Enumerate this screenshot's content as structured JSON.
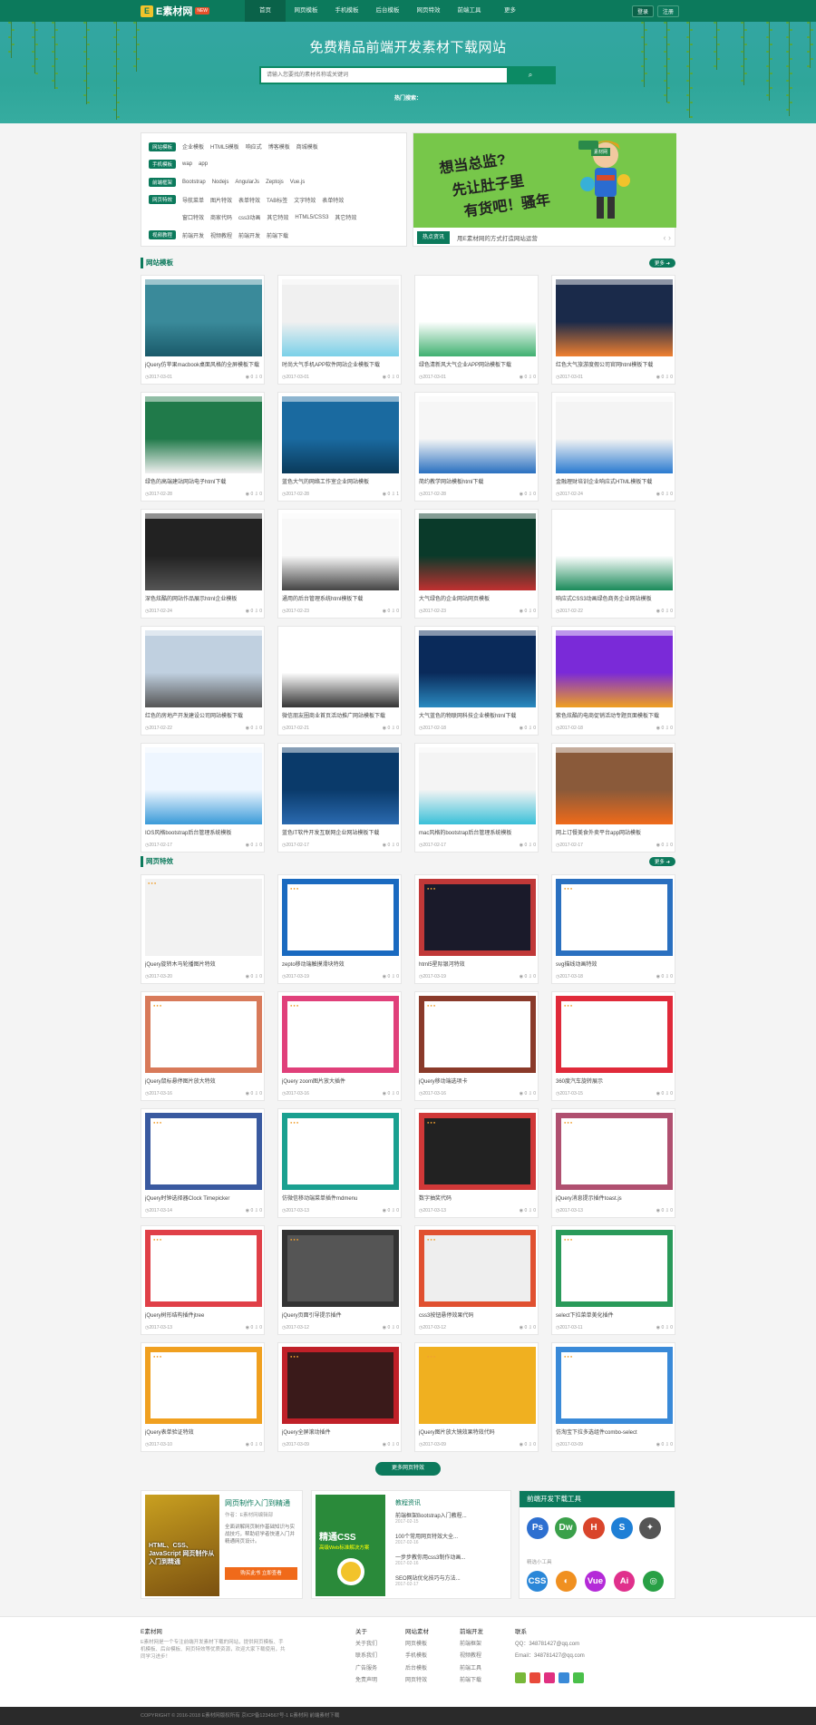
{
  "header": {
    "logo_mark": "E",
    "logo_name": "E素材网",
    "logo_tag": "NEW",
    "nav": [
      "首页",
      "网页模板",
      "手机模板",
      "后台模板",
      "网页特效",
      "前端工具",
      "更多"
    ],
    "login": "登录",
    "register": "注册"
  },
  "hero": {
    "title": "免费精品前端开发素材下载网站",
    "search_placeholder": "请输入您要找的素材名称或关键词",
    "search_button": "搜索",
    "hot_label": "热门搜索："
  },
  "categories": [
    {
      "label": "网站模板",
      "items": [
        "企业模板",
        "HTML5模板",
        "响应式",
        "博客模板",
        "商城模板"
      ]
    },
    {
      "label": "手机模板",
      "items": [
        "wap",
        "app"
      ]
    },
    {
      "label": "前端框架",
      "items": [
        "Bootstrap",
        "Nodejs",
        "AngularJs",
        "Zeptojs",
        "Vue.js"
      ]
    },
    {
      "label": "网页特效",
      "items": [
        "导航菜单",
        "图片特效",
        "表单特效",
        "TAB标签",
        "文字特效",
        "表单特效"
      ]
    },
    {
      "label": "",
      "items": [
        "窗口特效",
        "商家代码",
        "css3动画",
        "其它特效",
        "HTML5/CSS3",
        "其它特效"
      ]
    },
    {
      "label": "视频教程",
      "items": [
        "前端开发",
        "视频教程",
        "前端开发",
        "前端下载"
      ]
    }
  ],
  "banner": {
    "line1": "想当总监?",
    "line2": "先让肚子里",
    "line3": "有货吧！骚年",
    "badge": "素材网",
    "news_label": "热点资讯",
    "news_text": "用E素材网的方式打造网站运营"
  },
  "templates": {
    "title": "网站模板",
    "more": "更多",
    "items": [
      {
        "title": "jQuery仿苹果macbook桌面风格的全屏模板下载",
        "date": "2017-03-01",
        "views": "0",
        "downs": "0"
      },
      {
        "title": "时尚大气手机APP软件网站企业模板下载",
        "date": "2017-03-01",
        "views": "0",
        "downs": "0"
      },
      {
        "title": "绿色清新风大气企业APP网站模板下载",
        "date": "2017-03-01",
        "views": "0",
        "downs": "0"
      },
      {
        "title": "红色大气旅游度假公司官网html模板下载",
        "date": "2017-03-01",
        "views": "0",
        "downs": "0"
      },
      {
        "title": "绿色的高端建站网站电子html下载",
        "date": "2017-02-28",
        "views": "0",
        "downs": "0"
      },
      {
        "title": "蓝色大气的网络工作室企业网站模板",
        "date": "2017-02-28",
        "views": "0",
        "downs": "1"
      },
      {
        "title": "简约教学网站模板html下载",
        "date": "2017-02-28",
        "views": "0",
        "downs": "0"
      },
      {
        "title": "金融理财培训企业响应式HTML模板下载",
        "date": "2017-02-24",
        "views": "0",
        "downs": "0"
      },
      {
        "title": "深色炫酷的网站作品展示html企业模板",
        "date": "2017-02-24",
        "views": "0",
        "downs": "0"
      },
      {
        "title": "通用的后台管理系统html模板下载",
        "date": "2017-02-23",
        "views": "0",
        "downs": "0"
      },
      {
        "title": "大气绿色的企业网站网页模板",
        "date": "2017-02-23",
        "views": "0",
        "downs": "0"
      },
      {
        "title": "响应式CSS3动画绿色商务企业网站模板",
        "date": "2017-02-22",
        "views": "0",
        "downs": "0"
      },
      {
        "title": "红色的房地产开发建设公司网站模板下载",
        "date": "2017-02-22",
        "views": "0",
        "downs": "0"
      },
      {
        "title": "微信朋友圈商业首页活动推广网站模板下载",
        "date": "2017-02-21",
        "views": "0",
        "downs": "0"
      },
      {
        "title": "大气蓝色的物联网科技企业模板html下载",
        "date": "2017-02-18",
        "views": "0",
        "downs": "0"
      },
      {
        "title": "紫色炫酷的电商促销活动专题页面模板下载",
        "date": "2017-02-18",
        "views": "0",
        "downs": "0"
      },
      {
        "title": "IOS风格bootstrap后台管理系统模板",
        "date": "2017-02-17",
        "views": "0",
        "downs": "0"
      },
      {
        "title": "蓝色IT软件开发互联网企业网站模板下载",
        "date": "2017-02-17",
        "views": "0",
        "downs": "0"
      },
      {
        "title": "mac风格的bootstrap后台管理系统模板",
        "date": "2017-02-17",
        "views": "0",
        "downs": "0"
      },
      {
        "title": "网上订餐美食外卖平台app网站模板",
        "date": "2017-02-17",
        "views": "0",
        "downs": "0"
      }
    ]
  },
  "effects": {
    "title": "网页特效",
    "more": "更多",
    "items": [
      {
        "title": "jQuery旋转木马轮播图片特效",
        "date": "2017-03-20",
        "views": "0",
        "downs": "0"
      },
      {
        "title": "zepto移动端触摸滑块特效",
        "date": "2017-03-19",
        "views": "0",
        "downs": "0"
      },
      {
        "title": "html5星际银河特效",
        "date": "2017-03-19",
        "views": "0",
        "downs": "0"
      },
      {
        "title": "svg描线动画特效",
        "date": "2017-03-18",
        "views": "0",
        "downs": "0"
      },
      {
        "title": "jQuery鼠标悬停图片放大特效",
        "date": "2017-03-16",
        "views": "0",
        "downs": "0"
      },
      {
        "title": "jQuery zoom图片放大插件",
        "date": "2017-03-16",
        "views": "0",
        "downs": "0"
      },
      {
        "title": "jQuery移动端选项卡",
        "date": "2017-03-16",
        "views": "0",
        "downs": "0"
      },
      {
        "title": "360度汽车旋转展示",
        "date": "2017-03-15",
        "views": "0",
        "downs": "0"
      },
      {
        "title": "jQuery时钟选择器Clock Timepicker",
        "date": "2017-03-14",
        "views": "0",
        "downs": "0"
      },
      {
        "title": "仿微信移动端菜单插件mdmenu",
        "date": "2017-03-13",
        "views": "0",
        "downs": "0"
      },
      {
        "title": "数字抽奖代码",
        "date": "2017-03-13",
        "views": "0",
        "downs": "0"
      },
      {
        "title": "jQuery消息提示插件toast.js",
        "date": "2017-03-13",
        "views": "0",
        "downs": "0"
      },
      {
        "title": "jQuery树形结构插件jtree",
        "date": "2017-03-13",
        "views": "0",
        "downs": "0"
      },
      {
        "title": "jQuery页面引导提示插件",
        "date": "2017-03-12",
        "views": "0",
        "downs": "0"
      },
      {
        "title": "css3按钮悬停效果代码",
        "date": "2017-03-12",
        "views": "0",
        "downs": "0"
      },
      {
        "title": "select下拉菜单美化插件",
        "date": "2017-03-11",
        "views": "0",
        "downs": "0"
      },
      {
        "title": "jQuery表单验证特效",
        "date": "2017-03-10",
        "views": "0",
        "downs": "0"
      },
      {
        "title": "jQuery全屏滚动插件",
        "date": "2017-03-09",
        "views": "0",
        "downs": "0"
      },
      {
        "title": "jQuery图片放大镜效果特效代码",
        "date": "2017-03-09",
        "views": "0",
        "downs": "0"
      },
      {
        "title": "仿淘宝下拉多选组件combo-select",
        "date": "2017-03-09",
        "views": "0",
        "downs": "0"
      }
    ]
  },
  "load_more": "更多网页特效",
  "books": {
    "cover_title": "HTML、CSS、JavaScript 网页制作从入门到精通",
    "title": "网页制作入门到精通",
    "author": "作者：E素材网编辑部",
    "desc": "全面讲解网页制作基础知识与实战技巧，帮助初学者快速入门并精通网页设计。",
    "button": "购买此书 立即查看",
    "book2_title": "精通CSS",
    "book2_sub": "高级Web标准解决方案"
  },
  "articles": {
    "title": "教程资讯",
    "items": [
      {
        "title": "前端框架Bootstrap入门教程...",
        "date": "2017-02-15"
      },
      {
        "title": "100个常用网页特效大全...",
        "date": "2017-02-16"
      },
      {
        "title": "一步步教你用css3制作动画...",
        "date": "2017-02-16"
      },
      {
        "title": "SEO网站优化技巧与方法...",
        "date": "2017-02-17"
      }
    ]
  },
  "tools": {
    "title": "前端开发下载工具",
    "sub": "精选小工具",
    "top": [
      {
        "t": "Ps",
        "c": "#2d6fd0"
      },
      {
        "t": "Dw",
        "c": "#3aa04a"
      },
      {
        "t": "H",
        "c": "#d9452b"
      },
      {
        "t": "S",
        "c": "#1e7fd6"
      },
      {
        "t": "✦",
        "c": "#555"
      }
    ],
    "bottom": [
      {
        "t": "CSS",
        "c": "#2a87d8"
      },
      {
        "t": "◐",
        "c": "#f09020"
      },
      {
        "t": "Vue",
        "c": "#b42ad8"
      },
      {
        "t": "Ai",
        "c": "#e0308c"
      },
      {
        "t": "◎",
        "c": "#28a045"
      }
    ]
  },
  "footer": {
    "about_title": "E素材网",
    "about_text": "E素材网是一个专注前端开发素材下载的网站，提供网页模板、手机模板、后台模板、网页特效等优质资源，欢迎大家下载使用，共同学习进步！",
    "cols": [
      {
        "h": "关于",
        "items": [
          "关于我们",
          "联系我们",
          "广告服务",
          "免责声明"
        ]
      },
      {
        "h": "网站素材",
        "items": [
          "网页模板",
          "手机模板",
          "后台模板",
          "网页特效"
        ]
      },
      {
        "h": "前端开发",
        "items": [
          "前端框架",
          "视频教程",
          "前端工具",
          "前端下载"
        ]
      }
    ],
    "contact_title": "联系",
    "qq": "QQ：348781427@qq.com",
    "email": "Email：348781427@qq.com"
  },
  "copyright": "COPYRIGHT © 2016-2018 E素材网版权所有 京ICP备1234567号-1 E素材网 前端素材下载"
}
